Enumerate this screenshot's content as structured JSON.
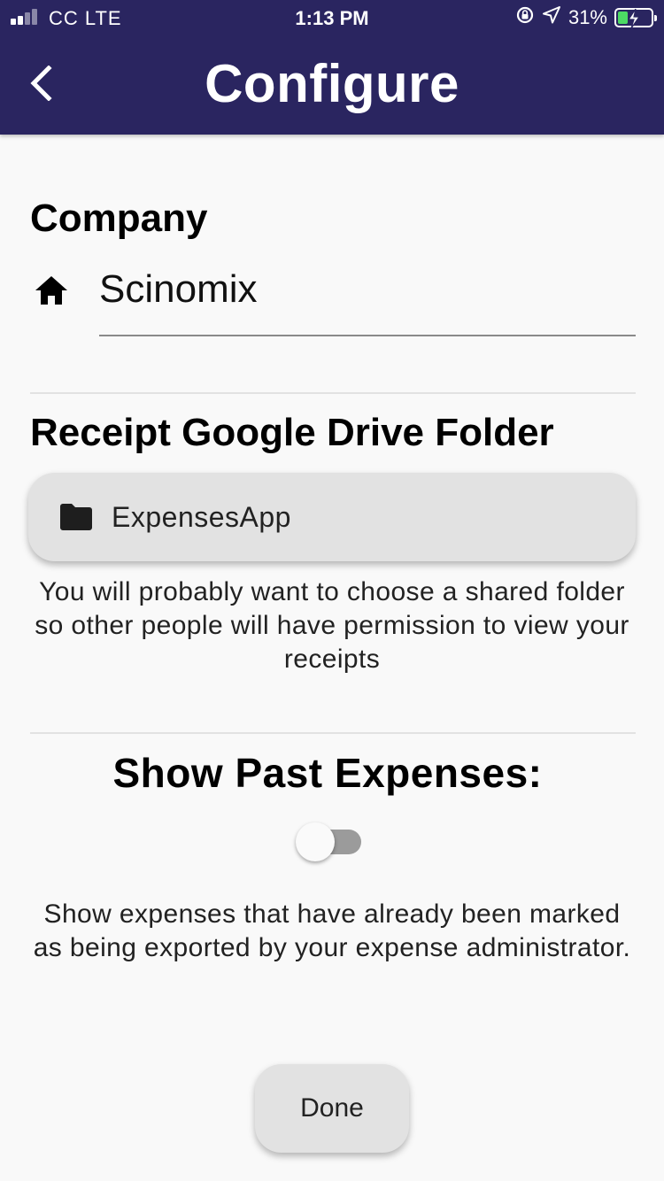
{
  "status_bar": {
    "carrier": "CC  LTE",
    "time": "1:13 PM",
    "battery_percent": "31%",
    "battery_level": 0.31,
    "icons": [
      "signal-icon",
      "orientation-lock-icon",
      "location-arrow-icon",
      "battery-charging-icon"
    ]
  },
  "app_bar": {
    "title": "Configure",
    "back_icon": "chevron-left-icon",
    "background_color": "#2a2560"
  },
  "company": {
    "heading": "Company",
    "icon": "home-icon",
    "value": "Scinomix"
  },
  "drive_folder": {
    "heading": "Receipt Google Drive Folder",
    "icon": "folder-icon",
    "folder_name": "ExpensesApp",
    "help_text": "You will probably want to choose a shared folder so other people will have permission to view your receipts"
  },
  "past_expenses": {
    "heading": "Show Past Expenses:",
    "enabled": false,
    "help_text": "Show expenses that have already been marked as being exported by your expense administrator."
  },
  "actions": {
    "done_label": "Done"
  }
}
